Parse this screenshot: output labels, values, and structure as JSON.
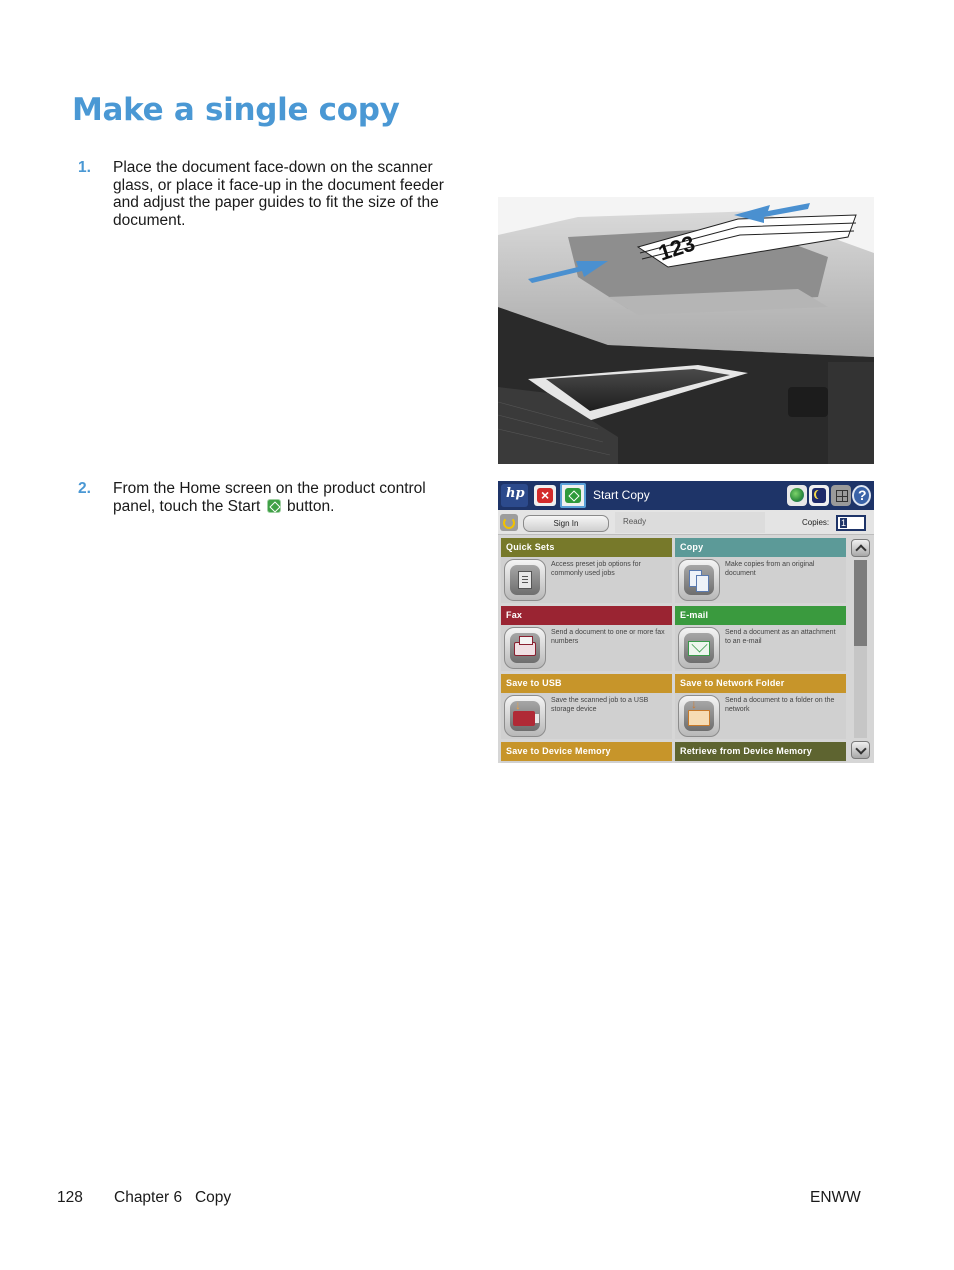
{
  "page": {
    "title": "Make a single copy",
    "steps": [
      {
        "number": "1.",
        "text": "Place the document face-down on the scanner glass, or place it face-up in the document feeder and adjust the paper guides to fit the size of the document."
      },
      {
        "number": "2.",
        "text_before": "From the Home screen on the product control panel, touch the Start",
        "icon": "start-icon",
        "text_after": "button."
      }
    ],
    "illustration": {
      "description": "Document feeder with paper stack labeled 123 and blue insertion arrows",
      "paper_label": "123",
      "arrow_color": "#4a90d0"
    },
    "footer": {
      "page_number": "128",
      "chapter": "Chapter 6   Copy",
      "right": "ENWW"
    },
    "colors": {
      "heading": "#4a98d4",
      "step_number": "#4a98d4"
    }
  },
  "control_panel": {
    "topbar": {
      "logo": "hp-logo",
      "stop_icon": "stop-icon",
      "start_icon": "start-icon",
      "title": "Start Copy",
      "right_icons": [
        "globe-icon",
        "sleep-icon",
        "network-icon",
        "help-icon"
      ]
    },
    "statusbar": {
      "reset_icon": "reset-icon",
      "sign_in_label": "Sign In",
      "status": "Ready",
      "copies_label": "Copies:",
      "copies_value": "1"
    },
    "tiles": [
      {
        "title": "Quick Sets",
        "description": "Access preset job options for commonly used jobs",
        "icon": "quick-sets-icon",
        "color": "#77792a"
      },
      {
        "title": "Copy",
        "description": "Make copies from an original document",
        "icon": "copy-icon",
        "color": "#5c9a98"
      },
      {
        "title": "Fax",
        "description": "Send a document to one or more fax numbers",
        "icon": "fax-icon",
        "color": "#9a2432"
      },
      {
        "title": "E-mail",
        "description": "Send a document as an attachment to an e-mail",
        "icon": "email-icon",
        "color": "#3a9a3e"
      },
      {
        "title": "Save to USB",
        "description": "Save the scanned job to a USB storage device",
        "icon": "usb-icon",
        "color": "#c7952a"
      },
      {
        "title": "Save to Network Folder",
        "description": "Send a document to a folder on the network",
        "icon": "network-folder-icon",
        "color": "#c7952a"
      },
      {
        "title": "Save to Device Memory",
        "description": "",
        "icon": "device-memory-icon",
        "color": "#c7952a"
      },
      {
        "title": "Retrieve from Device Memory",
        "description": "",
        "icon": "retrieve-memory-icon",
        "color": "#5e6430"
      }
    ]
  }
}
